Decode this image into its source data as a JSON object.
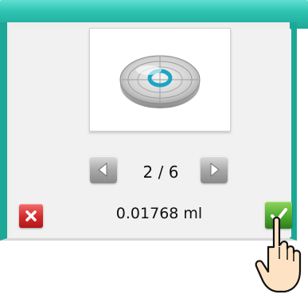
{
  "pager": {
    "current": 2,
    "total": 6,
    "text": "2 / 6"
  },
  "measurement": {
    "value": "0.01768 ml"
  },
  "icons": {
    "image": "bubble-level-icon",
    "previous": "arrow-left-icon",
    "next": "arrow-right-icon",
    "cancel": "close-icon",
    "confirm": "checkmark-icon",
    "pointer": "hand-pointer-icon"
  },
  "colors": {
    "header": "#2fc3b1",
    "frame": "#1ca896",
    "accent_ring": "#1aa6c4",
    "cancel": "#d22a2a",
    "confirm": "#4fa830"
  }
}
